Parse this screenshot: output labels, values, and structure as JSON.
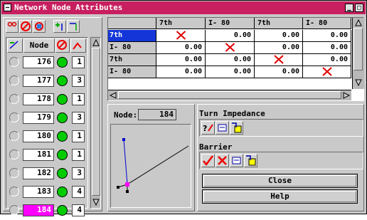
{
  "window": {
    "title": "Network Node Attributes"
  },
  "node_list": {
    "header_label": "Node",
    "rows": [
      {
        "node": "176",
        "degree": "1",
        "selected": false
      },
      {
        "node": "177",
        "degree": "3",
        "selected": false
      },
      {
        "node": "178",
        "degree": "1",
        "selected": false
      },
      {
        "node": "179",
        "degree": "3",
        "selected": false
      },
      {
        "node": "180",
        "degree": "1",
        "selected": false
      },
      {
        "node": "181",
        "degree": "1",
        "selected": false
      },
      {
        "node": "182",
        "degree": "3",
        "selected": false
      },
      {
        "node": "183",
        "degree": "4",
        "selected": false
      },
      {
        "node": "184",
        "degree": "4",
        "selected": true
      }
    ]
  },
  "turn_table": {
    "columns": [
      "7th",
      "I- 80",
      "7th",
      "I- 80"
    ],
    "rows": [
      {
        "label": "7th",
        "cells": [
          "X",
          "0.00",
          "0.00",
          "0.00"
        ]
      },
      {
        "label": "I- 80",
        "cells": [
          "0.00",
          "X",
          "0.00",
          "0.00"
        ]
      },
      {
        "label": "7th",
        "cells": [
          "0.00",
          "0.00",
          "X",
          "0.00"
        ]
      },
      {
        "label": "I- 80",
        "cells": [
          "0.00",
          "0.00",
          "0.00",
          "X"
        ]
      }
    ]
  },
  "node_panel": {
    "label": "Node:",
    "value": "184"
  },
  "turn_impedance": {
    "label": "Turn Impedance"
  },
  "barrier": {
    "label": "Barrier"
  },
  "buttons": {
    "close": "Close",
    "help": "Help"
  },
  "colors": {
    "title_bar": "#c71f5f",
    "selected_node": "#ff00ff",
    "node_status": "#00cc00",
    "x_mark": "#e00000"
  }
}
